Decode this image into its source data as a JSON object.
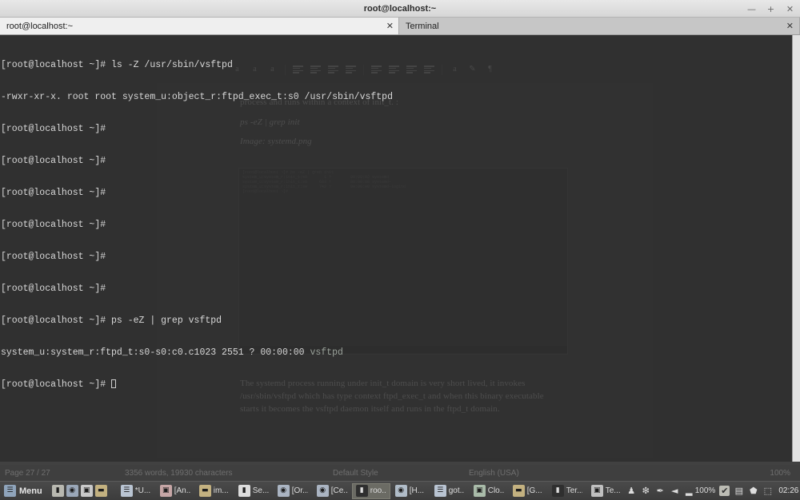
{
  "window": {
    "title": "root@localhost:~",
    "controls": [
      {
        "name": "minimize",
        "glyph": "—"
      },
      {
        "name": "maximize",
        "glyph": "+"
      },
      {
        "name": "close",
        "glyph": "✕"
      }
    ]
  },
  "tabs": [
    {
      "label": "root@localhost:~",
      "close": "✕",
      "active": true
    },
    {
      "label": "Terminal",
      "close": "✕",
      "active": false
    }
  ],
  "terminal": {
    "lines": [
      {
        "text": "[root@localhost ~]# ls -Z /usr/sbin/vsftpd"
      },
      {
        "text": "-rwxr-xr-x. root root system_u:object_r:ftpd_exec_t:s0 /usr/sbin/vsftpd"
      },
      {
        "text": "[root@localhost ~]#"
      },
      {
        "text": "[root@localhost ~]#"
      },
      {
        "text": "[root@localhost ~]#"
      },
      {
        "text": "[root@localhost ~]#"
      },
      {
        "text": "[root@localhost ~]#"
      },
      {
        "text": "[root@localhost ~]#"
      },
      {
        "text": "[root@localhost ~]# ps -eZ | grep vsftpd"
      },
      {
        "text": "system_u:system_r:ftpd_t:s0-s0:c0.c1023 2551 ? 00:00:00 ",
        "match": "vsftpd"
      },
      {
        "text": "[root@localhost ~]# ",
        "cursor": true
      }
    ]
  },
  "document": {
    "paragraph_1": "process and runs within a context of init_t. :",
    "command": "ps -eZ | grep init",
    "image_caption": "Image: systemd.png",
    "paragraph_2": "The systemd process running under init_t domain is very short lived, it invokes /usr/sbin/vsftpd which has type context ftpd_exec_t and when this binary executable starts it becomes the vsftpd daemon itself and runs in the ftpd_t domain.",
    "embedded_screenshot_text": "[root@localhost ~]# ps -eZ | grep init\nsystem_u:system_r:init_t:s0       1 ?        00:00:02 systemd\nsystem_u:system_r:init_t:s0     603 ?        00:00:00 systemd-\nsystem_u:system_r:init_t:s0     742 ?        00:00:00 systemd-logind\n[root@localhost ~]#",
    "status_bar": {
      "page": "Page 27 / 27",
      "word_count": "3356 words, 19930 characters",
      "style": "Default Style",
      "language": "English (USA)",
      "zoom": "100%"
    },
    "toolbar_icons": [
      "font-color-a-icon",
      "highlight-a-icon",
      "character-a-icon",
      "align-left-icon",
      "align-center-icon",
      "align-right-icon",
      "align-justify-icon",
      "bullet-list-icon",
      "number-list-icon",
      "decrease-indent-icon",
      "increase-indent-icon",
      "font-color-icon",
      "highlighting-icon",
      "paragraph-mark-icon"
    ]
  },
  "taskbar": {
    "menu_label": "Menu",
    "menu_icon": "menu-icon",
    "launchers": [
      {
        "name": "terminal-launcher",
        "icon": "terminal-icon",
        "color": "#b8b8b0"
      },
      {
        "name": "browser-launcher",
        "icon": "globe-icon",
        "color": "#9aa7b8"
      },
      {
        "name": "screenshot-launcher",
        "icon": "camera-icon",
        "color": "#c9c9c9"
      },
      {
        "name": "files-launcher",
        "icon": "folder-icon",
        "color": "#c3b180"
      }
    ],
    "tasks": [
      {
        "label": "*U...",
        "icon": "writer-icon",
        "color": "#b9c4d2",
        "active": false
      },
      {
        "label": "[An...",
        "icon": "impress-icon",
        "color": "#c6a6a6",
        "active": false
      },
      {
        "label": "im...",
        "icon": "folder-icon",
        "color": "#c3b180",
        "active": false
      },
      {
        "label": "Se...",
        "icon": "document-icon",
        "color": "#dcdcdc",
        "active": false
      },
      {
        "label": "[Or...",
        "icon": "browser-icon",
        "color": "#aab4c2",
        "active": false
      },
      {
        "label": "[Ce...",
        "icon": "browser-icon",
        "color": "#aab4c2",
        "active": false
      },
      {
        "label": "roo...",
        "icon": "terminal-icon",
        "color": "#3a3a3a",
        "active": true
      },
      {
        "label": "[H...",
        "icon": "browser-icon",
        "color": "#b0bcc8",
        "active": false
      },
      {
        "label": "got...",
        "icon": "writer-icon",
        "color": "#b9c4d2",
        "active": false
      },
      {
        "label": "Clo...",
        "icon": "impress-icon",
        "color": "#a9bba9",
        "active": false
      },
      {
        "label": "[G...",
        "icon": "folder-icon",
        "color": "#c3b180",
        "active": false
      },
      {
        "label": "Ter...",
        "icon": "terminal-icon",
        "color": "#3a3a3a",
        "active": false
      },
      {
        "label": "Te...",
        "icon": "camera-icon",
        "color": "#c0c0c0",
        "active": false
      }
    ],
    "tray": [
      {
        "name": "user-icon",
        "glyph": "♟"
      },
      {
        "name": "bluetooth-icon",
        "glyph": "❇"
      },
      {
        "name": "brightness-pen-icon",
        "glyph": "✒"
      },
      {
        "name": "volume-icon",
        "glyph": "◄"
      },
      {
        "name": "battery-icon",
        "glyph": "▂"
      }
    ],
    "battery_label": "100%",
    "tray_after": [
      {
        "name": "updates-icon",
        "glyph": "✔"
      },
      {
        "name": "display-icon",
        "glyph": "▤"
      },
      {
        "name": "security-shield-icon",
        "glyph": "⬟"
      },
      {
        "name": "network-icon",
        "glyph": "⬚"
      }
    ],
    "clock": "02:26",
    "show_desktop_icon": "show-desktop-icon"
  }
}
